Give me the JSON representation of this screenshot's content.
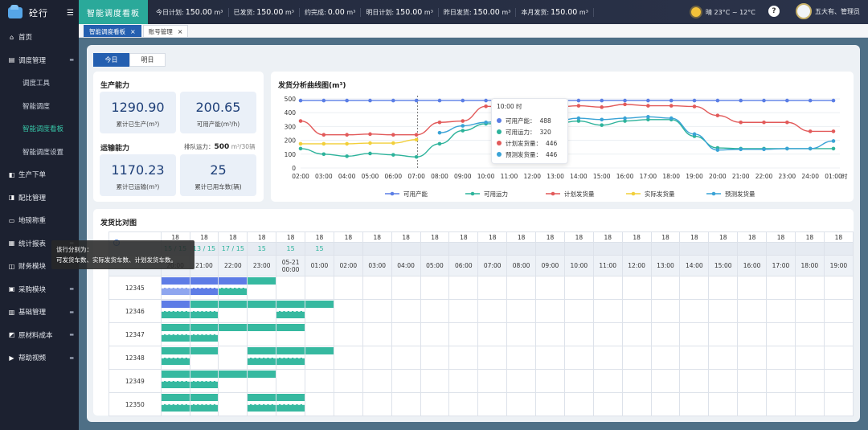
{
  "app": {
    "name": "砼行"
  },
  "sidebar": {
    "items": [
      {
        "label": "首页",
        "icon": "home-icon"
      },
      {
        "label": "调度管理",
        "icon": "dispatch-icon",
        "expanded": true
      },
      {
        "label": "调度工具",
        "sub": true
      },
      {
        "label": "智能调度",
        "sub": true
      },
      {
        "label": "智能调度看板",
        "sub": true,
        "active": true
      },
      {
        "label": "智能调度设置",
        "sub": true
      },
      {
        "label": "生产下单",
        "icon": "order-icon"
      },
      {
        "label": "配比管理",
        "icon": "mix-icon"
      },
      {
        "label": "地磅称重",
        "icon": "scale-icon"
      },
      {
        "label": "统计报表",
        "icon": "report-icon",
        "arrow": true
      },
      {
        "label": "财务模块",
        "icon": "finance-icon"
      },
      {
        "label": "采购模块",
        "icon": "purchase-icon",
        "arrow": true
      },
      {
        "label": "基础管理",
        "icon": "base-icon",
        "arrow": true
      },
      {
        "label": "原材料成本",
        "icon": "material-icon",
        "arrow": true
      },
      {
        "label": "帮助视频",
        "icon": "video-icon",
        "arrow": true
      }
    ]
  },
  "topbar": {
    "title": "智能调度看板",
    "stats": [
      {
        "label": "今日计划:",
        "value": "150.00",
        "unit": "m³"
      },
      {
        "label": "已发货:",
        "value": "150.00",
        "unit": "m³"
      },
      {
        "label": "约完成:",
        "value": "0.00",
        "unit": "m³"
      },
      {
        "label": "明日计划:",
        "value": "150.00",
        "unit": "m³"
      },
      {
        "label": "昨日发货:",
        "value": "150.00",
        "unit": "m³"
      },
      {
        "label": "本月发货:",
        "value": "150.00",
        "unit": "m³"
      }
    ],
    "weather": "晴  23°C ~ 12°C",
    "help": "?",
    "user": "五大有、管理员"
  },
  "page_tabs": [
    {
      "label": "智能调度看板",
      "active": true
    },
    {
      "label": "账号管理",
      "active": false
    }
  ],
  "day_tabs": [
    "今日",
    "明日"
  ],
  "production": {
    "title": "生产能力",
    "produced_value": "1290.90",
    "produced_label": "累计已生产(m³)",
    "capacity_value": "200.65",
    "capacity_label": "可用产能(m³/h)"
  },
  "transport": {
    "title": "运输能力",
    "fleet_label": "排队运力：",
    "fleet_value": "500",
    "fleet_unit": "m³/30辆",
    "shipped_value": "1170.23",
    "shipped_label": "累计已运输(m³)",
    "trucks_value": "25",
    "trucks_label": "累计已用车数(辆)"
  },
  "chart_data": {
    "type": "line",
    "title": "发货分析曲线图(m³)",
    "x": [
      "02:00",
      "03:00",
      "04:00",
      "05:00",
      "06:00",
      "07:00",
      "08:00",
      "09:00",
      "10:00",
      "11:00",
      "12:00",
      "13:00",
      "14:00",
      "15:00",
      "16:00",
      "17:00",
      "18:00",
      "19:00",
      "20:00",
      "21:00",
      "22:00",
      "23:00",
      "24:00",
      "01:00"
    ],
    "x_suffix": "时",
    "ylim": [
      0,
      500
    ],
    "yticks": [
      0,
      100,
      200,
      300,
      400,
      500
    ],
    "series": [
      {
        "name": "可用产能",
        "color": "#5b7ee5",
        "values": [
          488,
          488,
          488,
          488,
          488,
          488,
          488,
          488,
          488,
          488,
          488,
          488,
          488,
          488,
          488,
          488,
          488,
          488,
          488,
          488,
          488,
          488,
          488,
          488
        ]
      },
      {
        "name": "可用运力",
        "color": "#2db39b",
        "values": [
          140,
          100,
          85,
          105,
          95,
          80,
          175,
          270,
          320,
          320,
          330,
          320,
          340,
          310,
          340,
          350,
          350,
          230,
          145,
          140,
          140,
          140,
          140,
          140
        ]
      },
      {
        "name": "计划发货量",
        "color": "#e25a5a",
        "values": [
          340,
          240,
          240,
          245,
          240,
          240,
          330,
          340,
          446,
          440,
          440,
          440,
          450,
          440,
          460,
          450,
          450,
          445,
          380,
          330,
          330,
          330,
          265,
          265
        ]
      },
      {
        "name": "实际发货量",
        "color": "#f2cf3a",
        "values": [
          175,
          175,
          175,
          180,
          180,
          205,
          null,
          null,
          null,
          null,
          null,
          null,
          null,
          null,
          null,
          null,
          null,
          null,
          null,
          null,
          null,
          null,
          null,
          null
        ]
      },
      {
        "name": "预测发货量",
        "color": "#3aa3d6",
        "values": [
          null,
          null,
          null,
          null,
          null,
          null,
          255,
          305,
          330,
          350,
          350,
          340,
          360,
          350,
          360,
          370,
          360,
          245,
          130,
          135,
          135,
          140,
          140,
          195
        ]
      }
    ],
    "tooltip": {
      "title": "10:00 时",
      "rows": [
        {
          "label": "可用产能：",
          "value": "488",
          "color": "#5b7ee5"
        },
        {
          "label": "可用运力：",
          "value": "320",
          "color": "#2db39b"
        },
        {
          "label": "计划发货量：",
          "value": "446",
          "color": "#e25a5a"
        },
        {
          "label": "预测发货量：",
          "value": "446",
          "color": "#3aa3d6"
        }
      ]
    }
  },
  "schedule": {
    "title": "发货比对图",
    "tooltip_lines": [
      "该行分别为：",
      "可发货车数、实际发货车数、计划发货车数。"
    ],
    "times": [
      "20:00",
      "21:00",
      "22:00",
      "23:00",
      "05-21 00:00",
      "01:00",
      "02:00",
      "03:00",
      "04:00",
      "05:00",
      "06:00",
      "07:00",
      "08:00",
      "09:00",
      "10:00",
      "11:00",
      "12:00",
      "13:00",
      "14:00",
      "15:00",
      "16:00",
      "17:00",
      "18:00",
      "19:00"
    ],
    "available": [
      "18",
      "18",
      "18",
      "18",
      "18",
      "18",
      "18",
      "18",
      "18",
      "18",
      "18",
      "18",
      "18",
      "18",
      "18",
      "18",
      "18",
      "18",
      "18",
      "18",
      "18",
      "18",
      "18",
      "18"
    ],
    "counts": [
      "15 / 15",
      "13 / 15",
      "17 / 15",
      "15",
      "15",
      "15",
      "",
      "",
      "",
      "",
      "",
      "",
      "",
      "",
      "",
      "",
      "",
      "",
      "",
      "",
      "",
      "",
      "",
      ""
    ],
    "rows": [
      "12345",
      "12346",
      "12347",
      "12348",
      "12349",
      "12350"
    ]
  }
}
